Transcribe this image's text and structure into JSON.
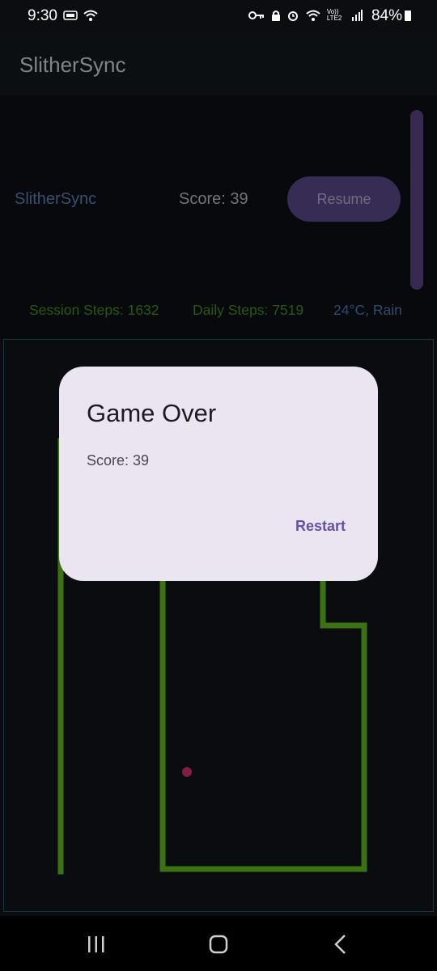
{
  "status_bar": {
    "time": "9:30",
    "left_icons": [
      "hd-icon",
      "wifi-icon"
    ],
    "right_icons": [
      "vpn-key-icon",
      "lock-icon",
      "alarm-icon",
      "wifi-calling-icon",
      "volte-icon",
      "signal-icon"
    ],
    "volte_label": "Vo)) LTE2",
    "battery": "84%"
  },
  "app_bar": {
    "title": "SlitherSync"
  },
  "panel": {
    "title": "SlitherSync",
    "score": "Score: 39",
    "resume_label": "Resume"
  },
  "stats": {
    "session": "Session Steps: 1632",
    "daily": "Daily Steps: 7519",
    "weather": "24°C, Rain"
  },
  "game": {
    "snake_color": "#3f7a16",
    "food_color": "#8b2144",
    "border_color": "#1a3a3e"
  },
  "dialog": {
    "title": "Game Over",
    "message": "Score: 39",
    "restart_label": "Restart"
  },
  "nav_bar": {
    "icons": [
      "recents-icon",
      "home-icon",
      "back-icon"
    ]
  }
}
